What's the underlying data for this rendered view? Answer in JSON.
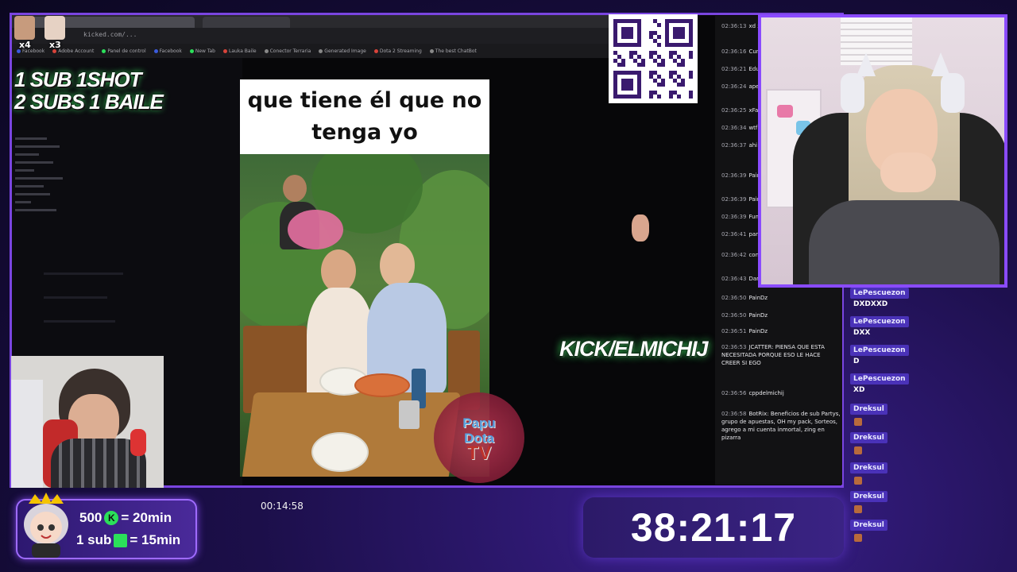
{
  "overlay": {
    "avatar_counts": [
      "x4",
      "x3"
    ],
    "sub_line_1": "1 SUB 1SHOT",
    "sub_line_2": "2 SUBS 1 BAILE",
    "kick_handle": "KICK/ELMICHIJ"
  },
  "browser": {
    "url": "kicked.com/...",
    "bookmarks": [
      "Facebook",
      "Adobe Account",
      "Panel de control",
      "Facebook",
      "New Tab",
      "Lauka Baile",
      "Conector Terraria",
      "Generated Image",
      "Dota 2 Streaming",
      "The best ChatBot"
    ]
  },
  "meme": {
    "caption_line_1": "que tiene él que no",
    "caption_line_2": "tenga yo"
  },
  "watermark": {
    "line_1": "Papu",
    "line_2": "Dota",
    "line_3": "TV"
  },
  "chat": {
    "messages": [
      {
        "time": "02:36:13",
        "text": "xd xd"
      },
      {
        "time": "02:36:16",
        "text": "Cuna"
      },
      {
        "time": "02:36:21",
        "text": "Edub"
      },
      {
        "time": "02:36:24",
        "text": "apellidos San"
      },
      {
        "time": "02:36:25",
        "text": "xFan"
      },
      {
        "time": "02:36:34",
        "text": "wtf"
      },
      {
        "time": "02:36:37",
        "text": "ahi va sacar s relevante"
      },
      {
        "time": "02:36:39",
        "text": "Pains"
      },
      {
        "time": "02:36:39",
        "text": "Pains"
      },
      {
        "time": "02:36:39",
        "text": "Funs"
      },
      {
        "time": "02:36:41",
        "text": "para estar ton"
      },
      {
        "time": "02:36:42",
        "text": "con la therian"
      },
      {
        "time": "02:36:43",
        "text": "Dark"
      },
      {
        "time": "02:36:50",
        "text": "PainDz"
      },
      {
        "time": "02:36:50",
        "text": "PainDz"
      },
      {
        "time": "02:36:51",
        "text": "PainDz"
      },
      {
        "time": "02:36:53",
        "text": "JCATTER: PIENSA QUE ESTA NECESITADA PORQUE ESO LE HACE CREER SI EGO"
      },
      {
        "time": "02:36:56",
        "text": "cppdelmichij"
      },
      {
        "time": "02:36:58",
        "text": "BotRix: Beneficios de sub Partys, grupo de apuestas, OH my pack, Sorteos, agrego a mi cuenta inmortal, zing en pizarra"
      }
    ]
  },
  "alerts": [
    {
      "user": "LePescuezon",
      "message": "DXDXXD"
    },
    {
      "user": "LePescuezon",
      "message": "DXX"
    },
    {
      "user": "LePescuezon",
      "message": "D"
    },
    {
      "user": "LePescuezon",
      "message": "XD"
    },
    {
      "user": "Dreksul",
      "message": ""
    },
    {
      "user": "Dreksul",
      "message": ""
    },
    {
      "user": "Dreksul",
      "message": ""
    },
    {
      "user": "Dreksul",
      "message": ""
    },
    {
      "user": "Dreksul",
      "message": ""
    }
  ],
  "goals": {
    "line_1_amount": "500",
    "line_1_reward": "= 20min",
    "line_2_amount": "1 sub",
    "line_2_reward": "= 15min"
  },
  "timers": {
    "elapsed": "00:14:58",
    "countdown": "38:21:17"
  },
  "colors": {
    "accent": "#7a45e0",
    "kick_green": "#2be05a",
    "alert_badge": "#4a32b8"
  },
  "icons": [
    "kick-coin-icon",
    "gift-icon",
    "crown-icon",
    "qr-code"
  ]
}
